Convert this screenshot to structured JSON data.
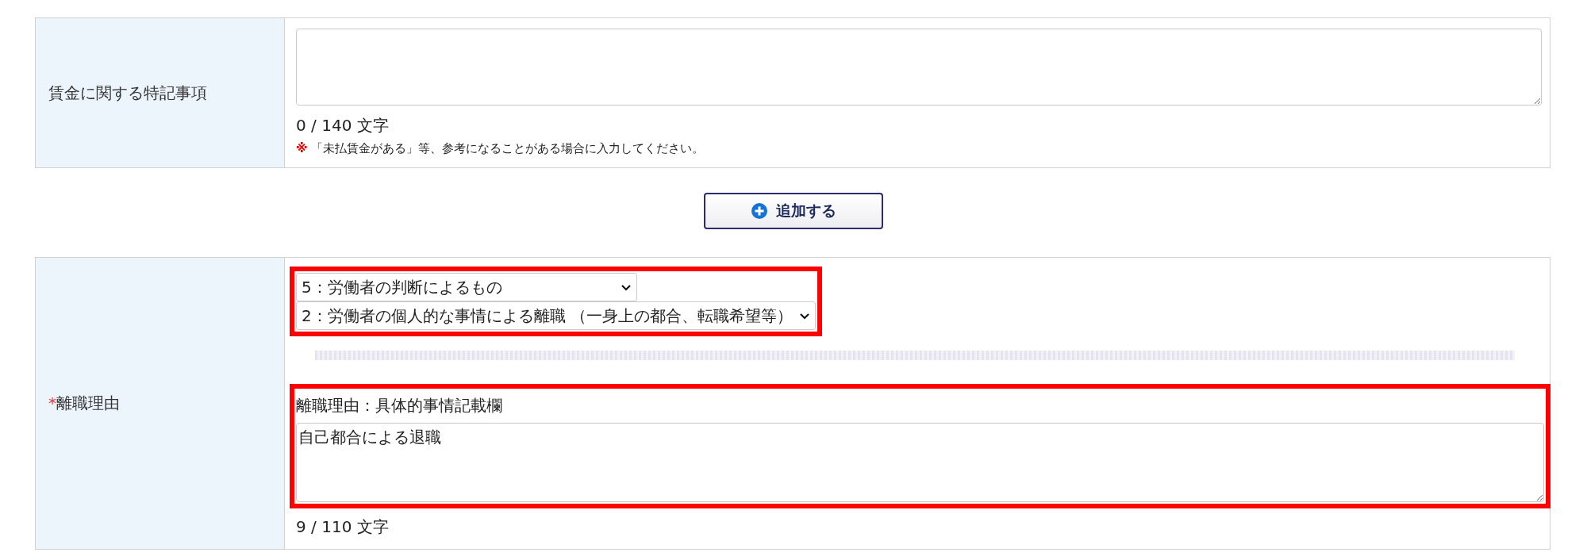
{
  "wage_notes": {
    "label": "賃金に関する特記事項",
    "counter": "0 / 140 文字",
    "note_mark": "※",
    "note": "「未払賃金がある」等、参考になることがある場合に入力してください。"
  },
  "add_button": {
    "label": "追加する"
  },
  "separation_reason": {
    "required_mark": "*",
    "label": "離職理由",
    "selects": [
      {
        "value": "5：労働者の判断によるもの"
      },
      {
        "value": "2：労働者の個人的な事情による離職 （一身上の都合、転職希望等）"
      }
    ],
    "selects_highlighted": true,
    "detail_label": "離職理由：具体的事情記載欄",
    "detail_value": "自己都合による退職",
    "detail_highlighted": true,
    "counter": "9 / 110 文字"
  }
}
